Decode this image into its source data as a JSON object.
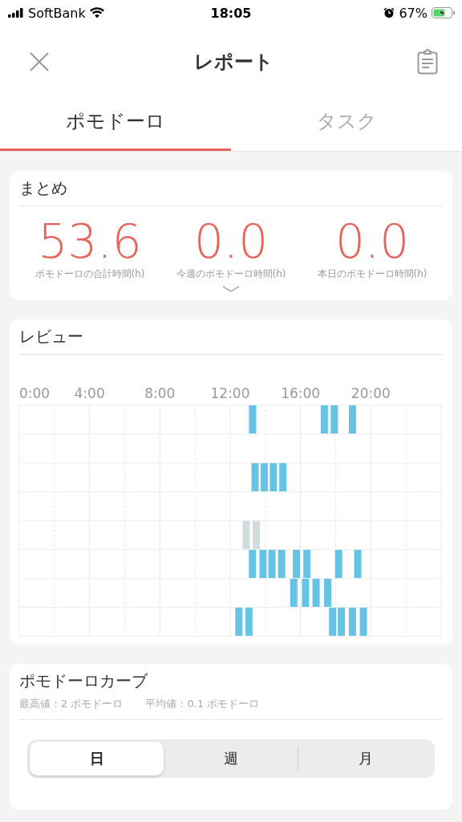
{
  "status_bar": {
    "carrier": "SoftBank",
    "time": "18:05",
    "battery": "67%",
    "charging": true
  },
  "nav": {
    "title": "レポート"
  },
  "tabs": [
    {
      "label": "ポモドーロ",
      "selected": true
    },
    {
      "label": "タスク",
      "selected": false
    }
  ],
  "summary": {
    "title": "まとめ",
    "stats": [
      {
        "value": "53.6",
        "label": "ポモドーロの合計時間(h)"
      },
      {
        "value": "0.0",
        "label": "今週のポモドーロ時間(h)"
      },
      {
        "value": "0.0",
        "label": "本日のポモドーロ時間(h)"
      }
    ]
  },
  "review": {
    "title": "レビュー",
    "time_labels": [
      "0:00",
      "4:00",
      "8:00",
      "12:00",
      "16:00",
      "20:00"
    ]
  },
  "curve": {
    "title": "ポモドーロカーブ",
    "stats": [
      "最高値：2 ポモドーロ",
      "平均値：0.1 ポモドーロ"
    ],
    "segments": [
      {
        "label": "日",
        "selected": true
      },
      {
        "label": "週",
        "selected": false
      },
      {
        "label": "月",
        "selected": false
      }
    ]
  }
}
